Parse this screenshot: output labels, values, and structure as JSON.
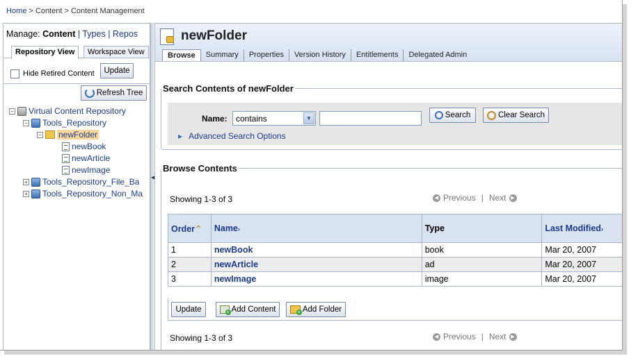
{
  "breadcrumb": {
    "home": "Home",
    "rest": " > Content > Content Management"
  },
  "left": {
    "manage_prefix": "Manage:",
    "manage_current": "Content",
    "manage_links": [
      "Types",
      "Repos"
    ],
    "subtabs": [
      "Repository View",
      "Workspace View"
    ],
    "hide_retired": "Hide Retired Content",
    "update": "Update",
    "refresh": "Refresh Tree",
    "tree": {
      "root": "Virtual Content Repository",
      "repo": "Tools_Repository",
      "folder": "newFolder",
      "items": [
        "newBook",
        "newArticle",
        "newImage"
      ],
      "others": [
        "Tools_Repository_File_Ba",
        "Tools_Repository_Non_Ma"
      ]
    }
  },
  "main": {
    "title": "newFolder",
    "tabs": [
      "Browse",
      "Summary",
      "Properties",
      "Version History",
      "Entitlements",
      "Delegated Admin"
    ],
    "search": {
      "legend": "Search Contents of newFolder",
      "name_label": "Name:",
      "operator": "contains",
      "value": "",
      "search_btn": "Search",
      "clear_btn": "Clear Search",
      "advanced": "Advanced Search Options"
    },
    "browse": {
      "legend": "Browse Contents",
      "showing": "Showing 1-3 of 3",
      "prev": "Previous",
      "next": "Next",
      "columns": [
        "Order",
        "Name",
        "Type",
        "Last Modified"
      ],
      "rows": [
        {
          "order": "1",
          "name": "newBook",
          "type": "book",
          "modified": "Mar 20, 2007"
        },
        {
          "order": "2",
          "name": "newArticle",
          "type": "ad",
          "modified": "Mar 20, 2007"
        },
        {
          "order": "3",
          "name": "newImage",
          "type": "image",
          "modified": "Mar 20, 2007"
        }
      ],
      "update": "Update",
      "add_content": "Add Content",
      "add_folder": "Add Folder"
    }
  }
}
